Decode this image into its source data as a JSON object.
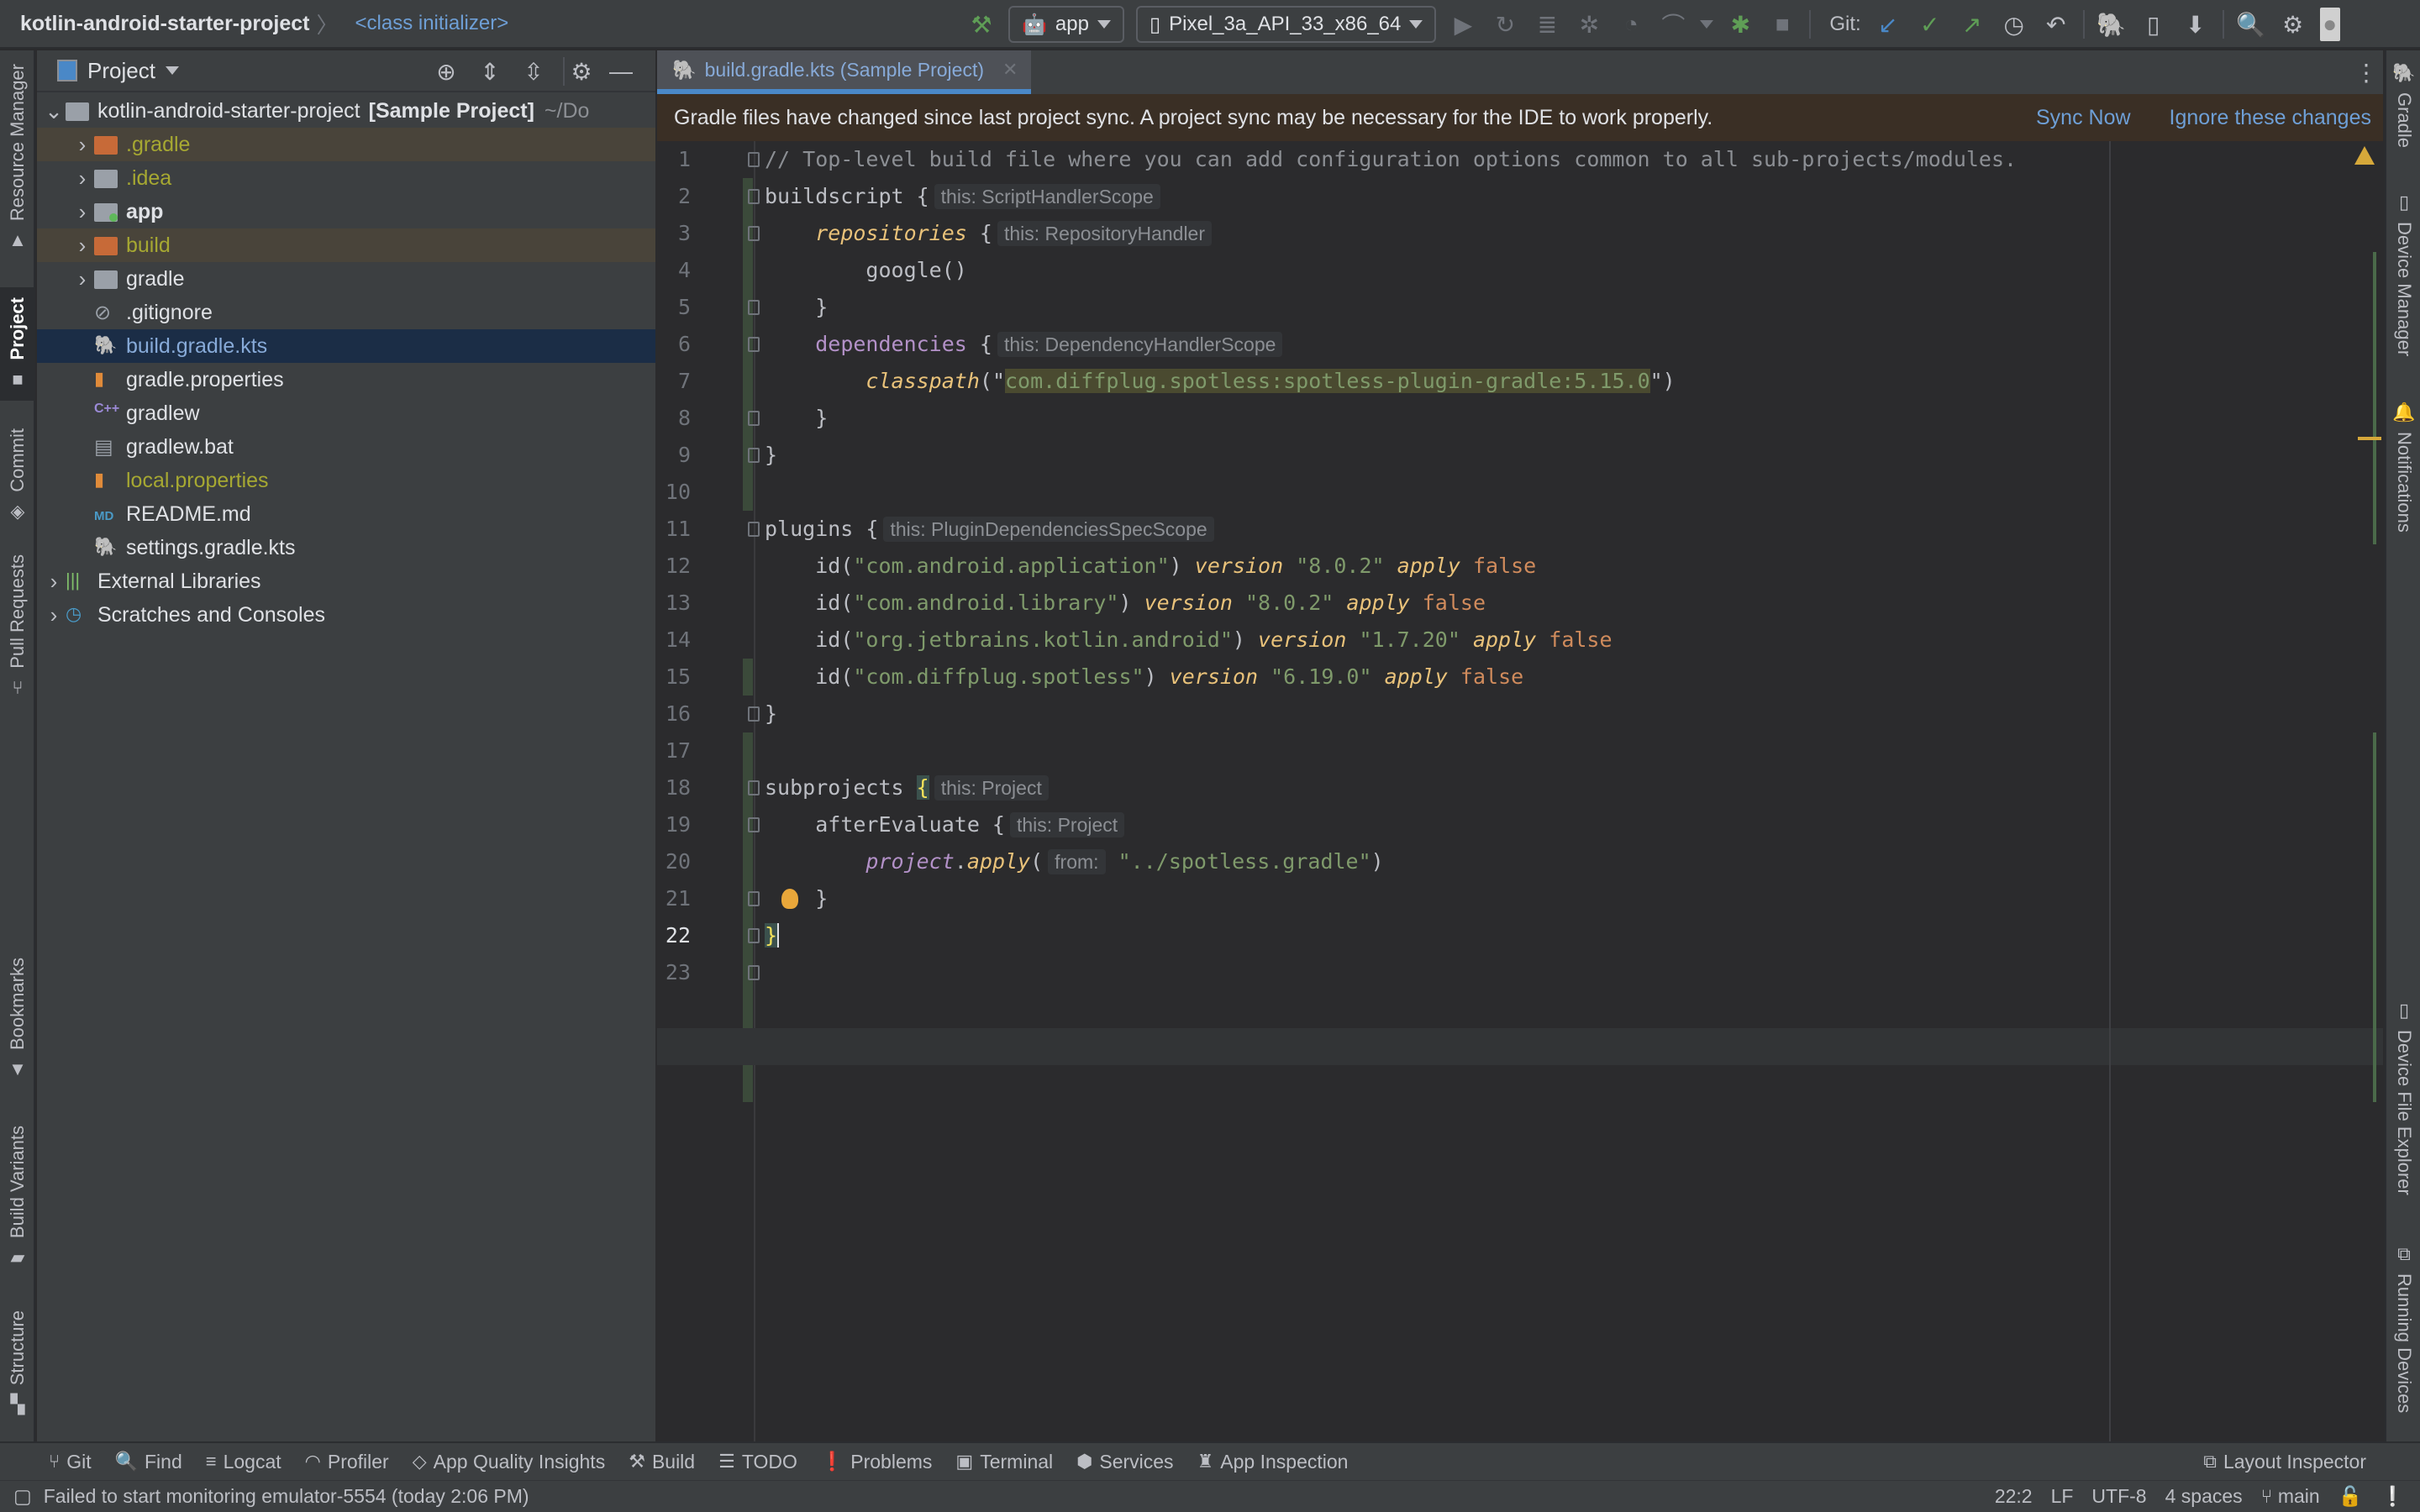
{
  "titlebar": {
    "project_name": "kotlin-android-starter-project",
    "breadcrumb_class": "<class initializer>",
    "run_config": "app",
    "device": "Pixel_3a_API_33_x86_64",
    "git_label": "Git:"
  },
  "left_strip": [
    {
      "label": "Resource Manager",
      "icon": "resource-manager-icon"
    },
    {
      "label": "Project",
      "icon": "folder-icon",
      "active": true
    },
    {
      "label": "Commit",
      "icon": "commit-icon"
    },
    {
      "label": "Pull Requests",
      "icon": "pull-request-icon"
    },
    {
      "label": "Bookmarks",
      "icon": "bookmark-icon"
    },
    {
      "label": "Build Variants",
      "icon": "android-icon"
    },
    {
      "label": "Structure",
      "icon": "structure-icon"
    }
  ],
  "right_strip": [
    {
      "label": "Gradle",
      "icon": "gradle-elephant-icon"
    },
    {
      "label": "Device Manager",
      "icon": "device-manager-icon"
    },
    {
      "label": "Notifications",
      "icon": "bell-icon"
    },
    {
      "label": "Device File Explorer",
      "icon": "phone-icon"
    },
    {
      "label": "Running Devices",
      "icon": "running-devices-icon"
    }
  ],
  "project_panel": {
    "title": "Project",
    "root": {
      "name": "kotlin-android-starter-project",
      "tag": "[Sample Project]",
      "path": "~/Do"
    },
    "items": [
      {
        "name": ".gradle",
        "type": "folder",
        "expandable": true,
        "ignored": true
      },
      {
        "name": ".idea",
        "type": "folder",
        "expandable": true,
        "ignored": false
      },
      {
        "name": "app",
        "type": "module",
        "expandable": true
      },
      {
        "name": "build",
        "type": "folder",
        "expandable": true,
        "ignored": true
      },
      {
        "name": "gradle",
        "type": "folder",
        "expandable": true
      },
      {
        "name": ".gitignore",
        "type": "file"
      },
      {
        "name": "build.gradle.kts",
        "type": "gradle-kts",
        "selected": true
      },
      {
        "name": "gradle.properties",
        "type": "properties"
      },
      {
        "name": "gradlew",
        "type": "shell"
      },
      {
        "name": "gradlew.bat",
        "type": "file"
      },
      {
        "name": "local.properties",
        "type": "properties",
        "ignored": true
      },
      {
        "name": "README.md",
        "type": "markdown"
      },
      {
        "name": "settings.gradle.kts",
        "type": "gradle-kts"
      }
    ],
    "extra": [
      {
        "name": "External Libraries"
      },
      {
        "name": "Scratches and Consoles"
      }
    ]
  },
  "editor": {
    "tab_label": "build.gradle.kts (Sample Project)",
    "banner": {
      "message": "Gradle files have changed since last project sync. A project sync may be necessary for the IDE to work properly.",
      "sync_now": "Sync Now",
      "ignore": "Ignore these changes"
    },
    "current_line": 22,
    "lines": [
      {
        "n": "1",
        "t1": "// Top-level build file where you can add configuration options common to all sub-projects/modules."
      },
      {
        "n": "2",
        "t1": "buildscript {",
        "hint": "this: ScriptHandlerScope"
      },
      {
        "n": "3",
        "t1": "repositories",
        "t2": " {",
        "hint": "this: RepositoryHandler"
      },
      {
        "n": "4",
        "t1": "google()"
      },
      {
        "n": "5",
        "t1": "}"
      },
      {
        "n": "6",
        "t1": "dependencies",
        "t2": " {",
        "hint": "this: DependencyHandlerScope"
      },
      {
        "n": "7",
        "t1": "classpath",
        "t2": "(\"",
        "t3": "com.diffplug.spotless:spotless-plugin-gradle:5.15.0",
        "t4": "\")"
      },
      {
        "n": "8",
        "t1": "}"
      },
      {
        "n": "9",
        "t1": "}"
      },
      {
        "n": "10",
        "t1": ""
      },
      {
        "n": "11",
        "t1": "plugins {",
        "hint": "this: PluginDependenciesSpecScope"
      },
      {
        "n": "12",
        "t1": "id(",
        "s": "\"com.android.application\"",
        "t2": ")",
        "ver": "\"8.0.2\""
      },
      {
        "n": "13",
        "t1": "id(",
        "s": "\"com.android.library\"",
        "t2": ")",
        "ver": "\"8.0.2\""
      },
      {
        "n": "14",
        "t1": "id(",
        "s": "\"org.jetbrains.kotlin.android\"",
        "t2": ")",
        "ver": "\"1.7.20\""
      },
      {
        "n": "15",
        "t1": "id(",
        "s": "\"com.diffplug.spotless\"",
        "t2": ")",
        "ver": "\"6.19.0\""
      },
      {
        "n": "16",
        "t1": "}"
      },
      {
        "n": "17",
        "t1": ""
      },
      {
        "n": "18",
        "t1": "subprojects ",
        "t2": "{",
        "hint": "this: Project"
      },
      {
        "n": "19",
        "t1": "afterEvaluate {",
        "hint": "this: Project"
      },
      {
        "n": "20",
        "t1": "project",
        "t2": ".",
        "t3": "apply",
        "t4": "(",
        "hint": "from:",
        "s": "\"../spotless.gradle\"",
        "t5": ")"
      },
      {
        "n": "21",
        "t1": "}"
      },
      {
        "n": "22",
        "t1": "}"
      },
      {
        "n": "23",
        "t1": ""
      }
    ],
    "kw_version": "version",
    "kw_apply": "apply",
    "kw_false": "false"
  },
  "bottom_tools": [
    "Git",
    "Find",
    "Logcat",
    "Profiler",
    "App Quality Insights",
    "Build",
    "TODO",
    "Problems",
    "Terminal",
    "Services",
    "App Inspection"
  ],
  "bottom_right_tool": "Layout Inspector",
  "status": {
    "message": "Failed to start monitoring emulator-5554 (today 2:06 PM)",
    "position": "22:2",
    "line_sep": "LF",
    "encoding": "UTF-8",
    "indent": "4 spaces",
    "branch": "main"
  },
  "colors": {
    "accent": "#4a88c7",
    "link": "#6e9fd6",
    "ignored_file": "#a6a832",
    "banner_bg": "#3a2f25",
    "selection": "#1b2d46"
  }
}
